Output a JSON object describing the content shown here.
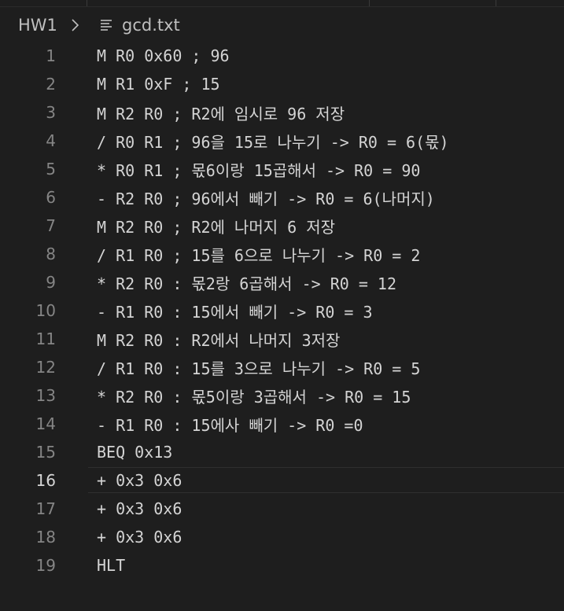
{
  "breadcrumb": {
    "folder": "HW1",
    "separator_icon": "chevron-right-icon",
    "file_icon": "text-file-icon",
    "file": "gcd.txt"
  },
  "editor": {
    "active_line": 16,
    "lines": [
      {
        "no": "1",
        "text": "M R0 0x60 ; 96"
      },
      {
        "no": "2",
        "text": "M R1 0xF ; 15"
      },
      {
        "no": "3",
        "text": "M R2 R0 ; R2에 임시로 96 저장"
      },
      {
        "no": "4",
        "text": "/ R0 R1 ; 96을 15로 나누기 -> R0 = 6(몫)"
      },
      {
        "no": "5",
        "text": "* R0 R1 ; 몫6이랑 15곱해서 -> R0 = 90"
      },
      {
        "no": "6",
        "text": "- R2 R0 ; 96에서 빼기 -> R0 = 6(나머지)"
      },
      {
        "no": "7",
        "text": "M R2 R0 ; R2에 나머지 6 저장"
      },
      {
        "no": "8",
        "text": "/ R1 R0 ; 15를 6으로 나누기 -> R0 = 2"
      },
      {
        "no": "9",
        "text": "* R2 R0 : 몫2랑 6곱해서 -> R0 = 12"
      },
      {
        "no": "10",
        "text": "- R1 R0 : 15에서 빼기 -> R0 = 3"
      },
      {
        "no": "11",
        "text": "M R2 R0 : R2에서 나머지 3저장"
      },
      {
        "no": "12",
        "text": "/ R1 R0 : 15를 3으로 나누기 -> R0 = 5"
      },
      {
        "no": "13",
        "text": "* R2 R0 : 몫5이랑 3곱해서 -> R0 = 15"
      },
      {
        "no": "14",
        "text": "- R1 R0 : 15에사 빼기 -> R0 =0"
      },
      {
        "no": "15",
        "text": "BEQ 0x13"
      },
      {
        "no": "16",
        "text": "+ 0x3 0x6"
      },
      {
        "no": "17",
        "text": "+ 0x3 0x6"
      },
      {
        "no": "18",
        "text": "+ 0x3 0x6"
      },
      {
        "no": "19",
        "text": "HLT"
      }
    ]
  }
}
